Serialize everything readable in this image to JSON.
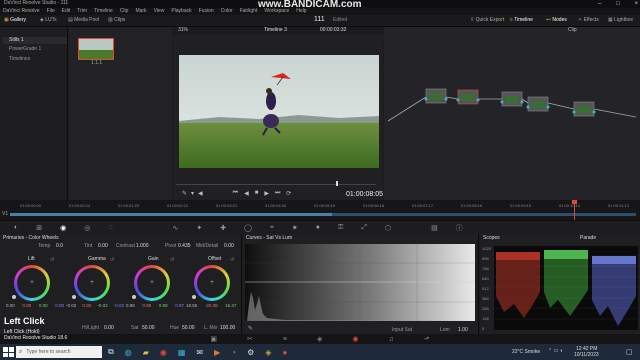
{
  "window": {
    "title": "DaVinci Resolve Studio - 111",
    "watermark": "www.BANDICAM.com"
  },
  "menu": [
    "DaVinci Resolve",
    "File",
    "Edit",
    "Trim",
    "Timeline",
    "Clip",
    "Mark",
    "View",
    "Playback",
    "Fusion",
    "Color",
    "Fairlight",
    "Workspace",
    "Help"
  ],
  "toolbar": {
    "gallery": "Gallery",
    "luts": "LUTs",
    "media_pool": "Media Pool",
    "clips": "Clips",
    "project_name": "111",
    "edited": "Edited",
    "quick_export": "Quick Export",
    "timeline": "Timeline",
    "nodes": "Nodes",
    "effects": "Effects",
    "lightbox": "Lightbox"
  },
  "viewer_bar": {
    "zoom": "31%",
    "timeline_name": "Timeline 3",
    "timecode": "00:00:03:32",
    "clip_label": "Clip"
  },
  "gallery": {
    "items": [
      "Stills 1",
      "PowerGrade 1",
      "Timelines"
    ],
    "thumb_label": "1.1.1"
  },
  "viewer": {
    "timecode": "01:00:08:05"
  },
  "ruler": {
    "ticks": [
      "01:00:00:00",
      "01:00:00:24",
      "01:00:01:23",
      "01:00:02:22",
      "01:00:03:21",
      "01:00:04:20",
      "01:00:05:19",
      "01:00:06:18",
      "01:00:07:17",
      "01:00:08:16",
      "01:00:09:15",
      "01:00:10:14",
      "01:00:11:13"
    ],
    "v1": "V1"
  },
  "primaries": {
    "title": "Primaries - Color Wheels",
    "top": {
      "temp_l": "Temp",
      "temp_v": "0.0",
      "tint_l": "Tint",
      "tint_v": "0.00",
      "contrast_l": "Contrast",
      "contrast_v": "1.000",
      "pivot_l": "Pivot",
      "pivot_v": "0.435",
      "middetail_l": "Mid/Detail",
      "middetail_v": "0.00"
    },
    "wheels": [
      {
        "label": "Lift",
        "vals": [
          "0.00",
          "0.00",
          "0.00",
          "0.00"
        ]
      },
      {
        "label": "Gamma",
        "vals": [
          "-0.02",
          "0.00",
          "-0.02",
          "-0.03"
        ]
      },
      {
        "label": "Gain",
        "vals": [
          "0.98",
          "0.98",
          "0.98",
          "0.97"
        ]
      },
      {
        "label": "Offset",
        "vals": [
          "18.55",
          "-20.39",
          "16.47",
          ""
        ]
      }
    ],
    "bottom": {
      "hl_l": "Hi/Light",
      "hl_v": "0.00",
      "sat_l": "Sat",
      "sat_v": "50.00",
      "hue_l": "Hue",
      "hue_v": "50.00",
      "lmix_l": "L. Mix",
      "lmix_v": "100.00"
    }
  },
  "curves": {
    "title": "Curves - Sat Vs Lum",
    "input_sat_l": "Input Sat",
    "lum_l": "Lum",
    "lum_v": "1.00"
  },
  "scopes": {
    "title": "Scopes",
    "mode": "Parade",
    "scale": [
      "1023",
      "896",
      "768",
      "640",
      "512",
      "384",
      "256",
      "128",
      "0"
    ]
  },
  "overlay": {
    "left_click": "Left Click",
    "hint1": "Left Click (Hold)",
    "hint2": "DaVinci Resolve Studio 18.6"
  },
  "taskbar": {
    "search": "Type here to search",
    "weather": "22°C Smoke",
    "time": "12:42 PM",
    "date": "10/11/2023"
  },
  "colors": {
    "accent": "#d84a3a",
    "teal": "#3fb3d6"
  }
}
